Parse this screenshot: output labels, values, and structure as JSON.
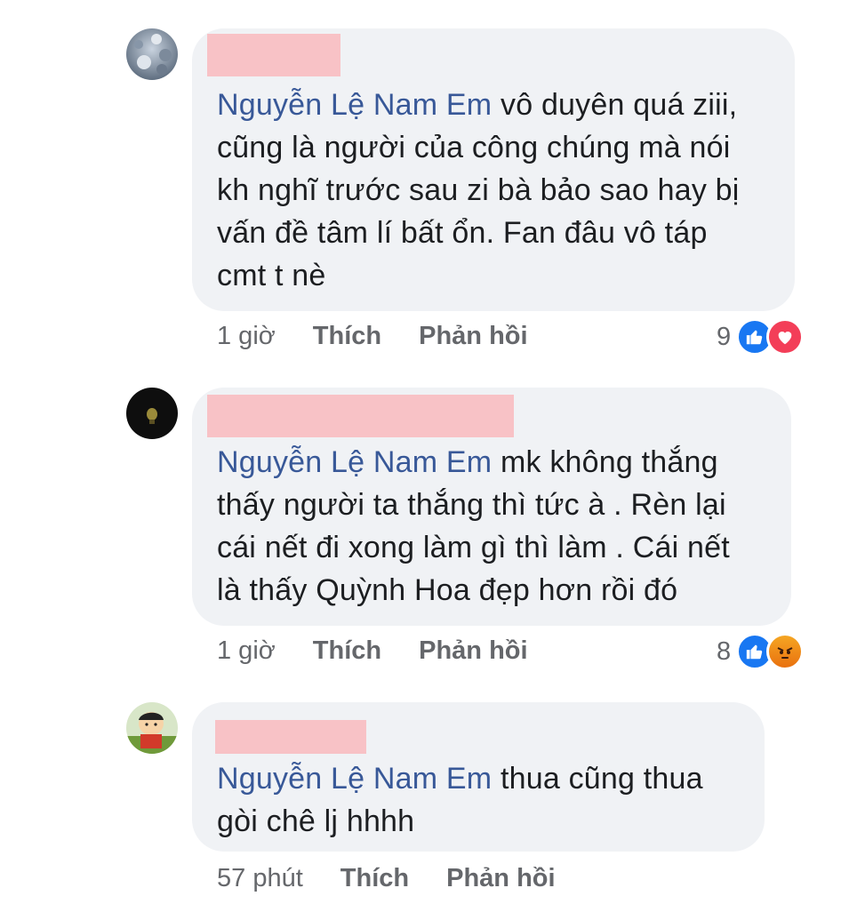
{
  "comments": [
    {
      "mention": "Nguyễn Lệ Nam Em",
      "lines": [
        " vô duyên quá ziii,",
        "cũng là người của công chúng mà nói",
        "kh nghĩ trước sau zi bà bảo sao hay bị",
        "vấn đề tâm lí bất ổn. Fan đâu vô táp",
        "cmt t nè"
      ],
      "time": "1 giờ",
      "like_label": "Thích",
      "reply_label": "Phản hồi",
      "reaction_count": "9",
      "reactions": [
        "like-icon",
        "love-icon"
      ]
    },
    {
      "mention": "Nguyễn Lệ Nam Em",
      "lines": [
        " mk không thắng",
        "thấy người ta thắng thì tức à . Rèn lại",
        "cái nết đi xong làm gì thì làm . Cái nết",
        "là thấy Quỳnh Hoa đẹp hơn rồi đó"
      ],
      "time": "1 giờ",
      "like_label": "Thích",
      "reply_label": "Phản hồi",
      "reaction_count": "8",
      "reactions": [
        "like-icon",
        "angry-icon"
      ]
    },
    {
      "mention": "Nguyễn Lệ Nam Em",
      "lines": [
        " thua cũng thua",
        "gòi chê lj hhhh"
      ],
      "time": "57 phút",
      "like_label": "Thích",
      "reply_label": "Phản hồi"
    }
  ],
  "colors": {
    "mention": "#385898",
    "bubble": "#f0f2f5",
    "redaction": "#f8c2c6",
    "like": "#1877f2",
    "love": "#f33e58"
  }
}
